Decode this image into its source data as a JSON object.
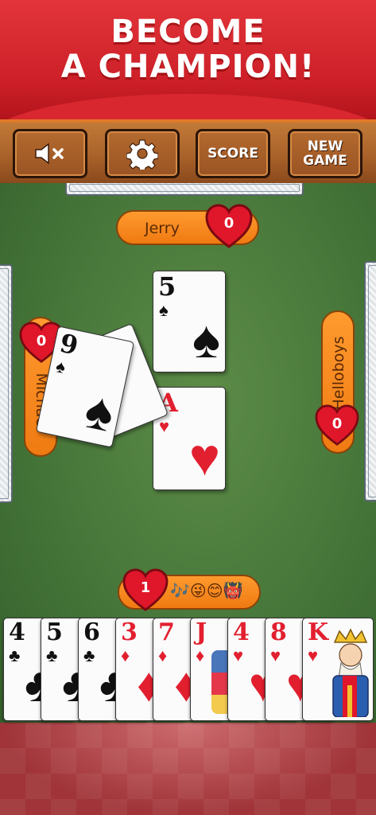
{
  "banner": {
    "line1": "BECOME",
    "line2": "A CHAMPION!"
  },
  "toolbar": {
    "mute_icon": "speaker-mute-icon",
    "settings_icon": "gear-icon",
    "score_label": "SCORE",
    "new_game_line1": "NEW",
    "new_game_line2": "GAME"
  },
  "players": {
    "top": {
      "name": "Jerry",
      "score": "0"
    },
    "left": {
      "name": "Michael",
      "score": "0"
    },
    "right": {
      "name": "Helloboys",
      "score": "0"
    },
    "me": {
      "score": "1",
      "emojis": "🎶😜😊👹"
    }
  },
  "trick": [
    {
      "rank": "5",
      "suit": "♠",
      "color": "black"
    },
    {
      "rank": "A",
      "suit": "♥",
      "color": "red"
    },
    {
      "rank": "9",
      "suit": "♠",
      "color": "black"
    }
  ],
  "hand": [
    {
      "rank": "4",
      "suit": "♣",
      "color": "black"
    },
    {
      "rank": "5",
      "suit": "♣",
      "color": "black"
    },
    {
      "rank": "6",
      "suit": "♣",
      "color": "black"
    },
    {
      "rank": "3",
      "suit": "♦",
      "color": "red"
    },
    {
      "rank": "7",
      "suit": "♦",
      "color": "red"
    },
    {
      "rank": "J",
      "suit": "♦",
      "color": "red"
    },
    {
      "rank": "4",
      "suit": "♥",
      "color": "red"
    },
    {
      "rank": "8",
      "suit": "♥",
      "color": "red"
    },
    {
      "rank": "K",
      "suit": "♥",
      "color": "red"
    }
  ],
  "colors": {
    "banner": "#d9272f",
    "felt": "#4a7a3c",
    "pill": "#ef7a12",
    "heart": "#e0162b",
    "wood": "#a9622a"
  }
}
